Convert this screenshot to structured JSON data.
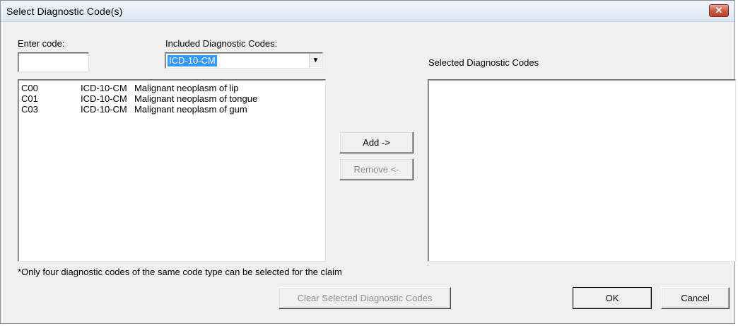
{
  "window": {
    "title": "Select Diagnostic Code(s)",
    "close_glyph": "✕"
  },
  "enter_code": {
    "label": "Enter code:",
    "value": ""
  },
  "included": {
    "label": "Included Diagnostic Codes:",
    "selected": "ICD-10-CM",
    "arrow_glyph": "▼"
  },
  "available_list": {
    "rows": [
      {
        "code": "C00",
        "type": "ICD-10-CM",
        "description": "Malignant neoplasm of lip"
      },
      {
        "code": "C01",
        "type": "ICD-10-CM",
        "description": "Malignant neoplasm of tongue"
      },
      {
        "code": "C03",
        "type": "ICD-10-CM",
        "description": "Malignant neoplasm of gum"
      }
    ]
  },
  "selected_list": {
    "label": "Selected Diagnostic Codes",
    "rows": []
  },
  "buttons": {
    "add": "Add ->",
    "remove": "Remove <-",
    "clear": "Clear Selected Diagnostic Codes",
    "ok": "OK",
    "cancel": "Cancel"
  },
  "footnote": "*Only four diagnostic codes of the same code type can be selected for the claim"
}
